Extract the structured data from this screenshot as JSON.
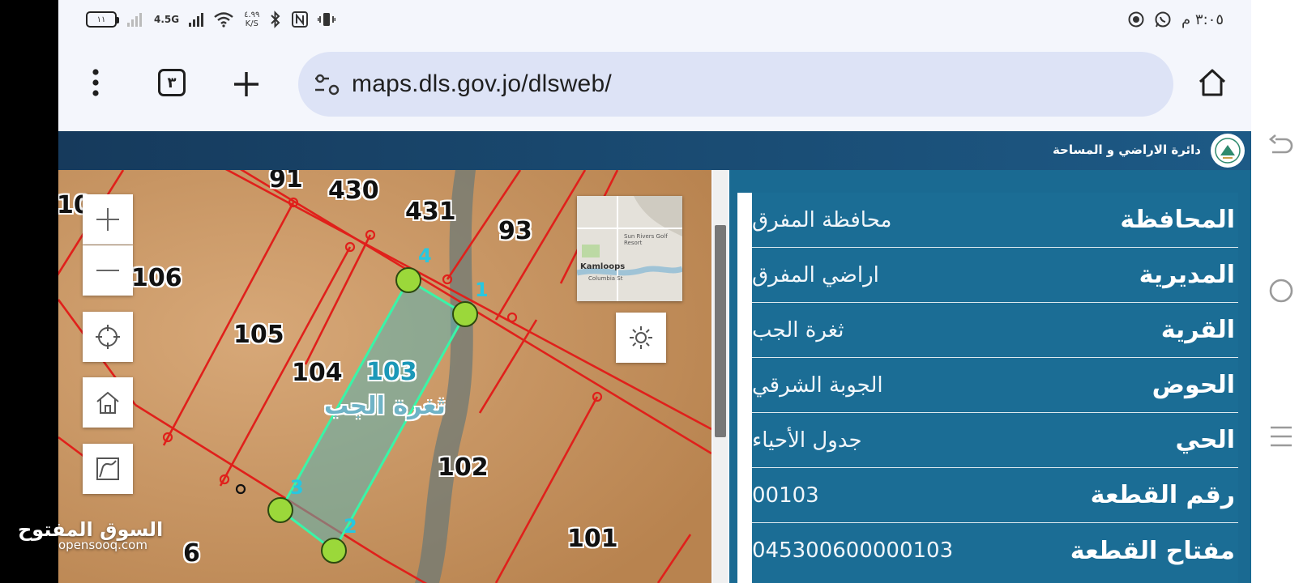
{
  "status_bar": {
    "time": "٣:٠٥ م",
    "battery": "١١",
    "network": "4.5G",
    "net_speed": "٤.٩٩",
    "net_speed_unit": "K/S"
  },
  "browser": {
    "url": "maps.dls.gov.jo/dlsweb/",
    "tab_count": "٣"
  },
  "app": {
    "title": "دائرة الاراضي و المساحة"
  },
  "map": {
    "parcel_labels": [
      "91",
      "430",
      "431",
      "93",
      "106",
      "105",
      "104",
      "103",
      "102",
      "101",
      "6",
      "10"
    ],
    "village_label": "ثغرة الجب",
    "vertex_labels": [
      "1",
      "2",
      "3",
      "4"
    ],
    "inset_place": "Kamloops",
    "inset_poi": "Sun Rivers Golf Resort",
    "inset_street": "Columbia St"
  },
  "parcel_info": [
    {
      "label": "المحافظة",
      "value": "محافظة المفرق"
    },
    {
      "label": "المديرية",
      "value": "اراضي المفرق"
    },
    {
      "label": "القرية",
      "value": "ثغرة الجب"
    },
    {
      "label": "الحوض",
      "value": "الجوبة الشرقي"
    },
    {
      "label": "الحي",
      "value": "جدول الأحياء"
    },
    {
      "label": "رقم القطعة",
      "value": "00103"
    },
    {
      "label": "مفتاح القطعة",
      "value": "045300600000103"
    }
  ],
  "watermark": {
    "arabic": "السوق المفتوح",
    "latin": "opensooq.com"
  },
  "colors": {
    "panel": "#1b6d95",
    "header": "#163a5c",
    "parcel_line": "#e0201b",
    "selected_outline": "#39f5a8",
    "vertex": "#9bd83a"
  }
}
